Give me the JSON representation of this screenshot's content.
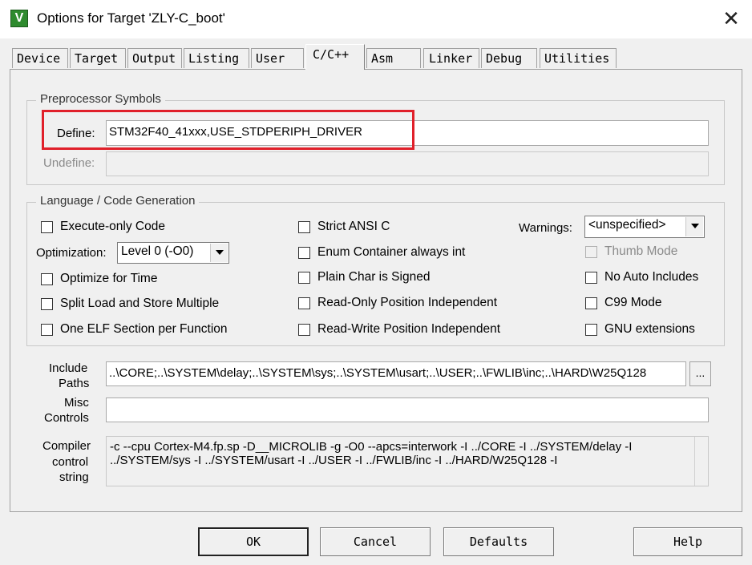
{
  "window": {
    "title": "Options for Target 'ZLY-C_boot'",
    "app_icon_glyph": "V",
    "close_glyph": "✕"
  },
  "tabs": [
    {
      "label": "Device"
    },
    {
      "label": "Target"
    },
    {
      "label": "Output"
    },
    {
      "label": "Listing"
    },
    {
      "label": "User"
    },
    {
      "label": "C/C++",
      "active": true
    },
    {
      "label": "Asm"
    },
    {
      "label": "Linker"
    },
    {
      "label": "Debug"
    },
    {
      "label": "Utilities"
    }
  ],
  "preprocessor": {
    "group_label": "Preprocessor Symbols",
    "define_label": "Define:",
    "define_value": "STM32F40_41xxx,USE_STDPERIPH_DRIVER",
    "undefine_label": "Undefine:",
    "undefine_value": ""
  },
  "language": {
    "group_label": "Language / Code Generation",
    "execute_only": {
      "label": "Execute-only Code",
      "checked": false
    },
    "optimization_label": "Optimization:",
    "optimization_value": "Level 0 (-O0)",
    "optimize_time": {
      "label": "Optimize for Time",
      "checked": false
    },
    "split_load": {
      "label": "Split Load and Store Multiple",
      "checked": false
    },
    "one_elf": {
      "label": "One ELF Section per Function",
      "checked": false
    },
    "strict_ansi": {
      "label": "Strict ANSI C",
      "checked": false
    },
    "enum_container": {
      "label": "Enum Container always int",
      "checked": false
    },
    "plain_char": {
      "label": "Plain Char is Signed",
      "checked": false
    },
    "ro_pos": {
      "label": "Read-Only Position Independent",
      "checked": false
    },
    "rw_pos": {
      "label": "Read-Write Position Independent",
      "checked": false
    },
    "warnings_label": "Warnings:",
    "warnings_value": "<unspecified>",
    "thumb_mode": {
      "label": "Thumb Mode",
      "checked": false,
      "disabled": true
    },
    "no_auto_includes": {
      "label": "No Auto Includes",
      "checked": false
    },
    "c99_mode": {
      "label": "C99 Mode",
      "checked": false
    },
    "gnu_ext": {
      "label": "GNU extensions",
      "checked": false
    }
  },
  "include": {
    "label_line1": "Include",
    "label_line2": "Paths",
    "value": "..\\CORE;..\\SYSTEM\\delay;..\\SYSTEM\\sys;..\\SYSTEM\\usart;..\\USER;..\\FWLIB\\inc;..\\HARD\\W25Q128",
    "browse_label": "..."
  },
  "misc": {
    "label_line1": "Misc",
    "label_line2": "Controls",
    "value": ""
  },
  "compiler": {
    "label_line1": "Compiler",
    "label_line2": "control",
    "label_line3": "string",
    "line1": "-c --cpu Cortex-M4.fp.sp -D__MICROLIB -g -O0 --apcs=interwork -I ../CORE -I ../SYSTEM/delay -I",
    "line2": "../SYSTEM/sys -I ../SYSTEM/usart -I ../USER -I ../FWLIB/inc -I ../HARD/W25Q128 -I"
  },
  "buttons": {
    "ok": "OK",
    "cancel": "Cancel",
    "defaults": "Defaults",
    "help": "Help"
  },
  "colors": {
    "highlight": "#e0202a",
    "app_icon": "#2e8b2e"
  }
}
